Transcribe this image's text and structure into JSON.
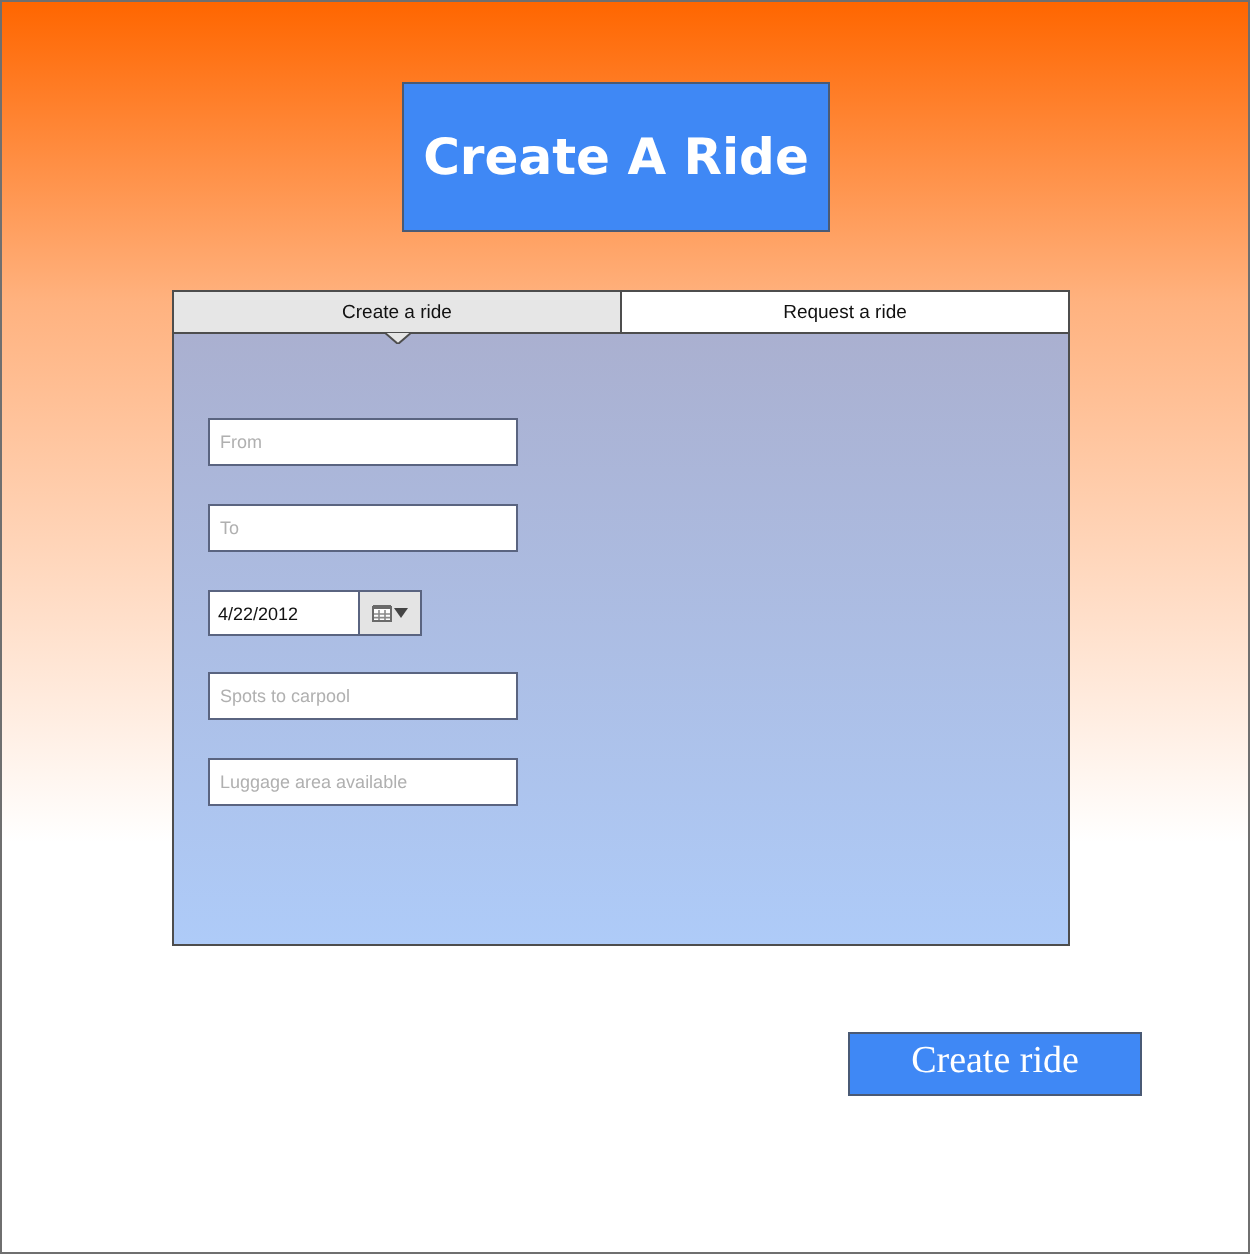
{
  "title": "Create A Ride",
  "tabs": [
    {
      "label": "Create a ride",
      "selected": true
    },
    {
      "label": "Request a ride",
      "selected": false
    }
  ],
  "form": {
    "fields": [
      {
        "kind": "text",
        "placeholder": "From"
      },
      {
        "kind": "text",
        "placeholder": "To"
      },
      {
        "kind": "date",
        "value": "4/22/2012"
      },
      {
        "kind": "text",
        "placeholder": "Spots to carpool"
      },
      {
        "kind": "text",
        "placeholder": "Luggage area available"
      }
    ]
  },
  "submit_button": "Create ride"
}
